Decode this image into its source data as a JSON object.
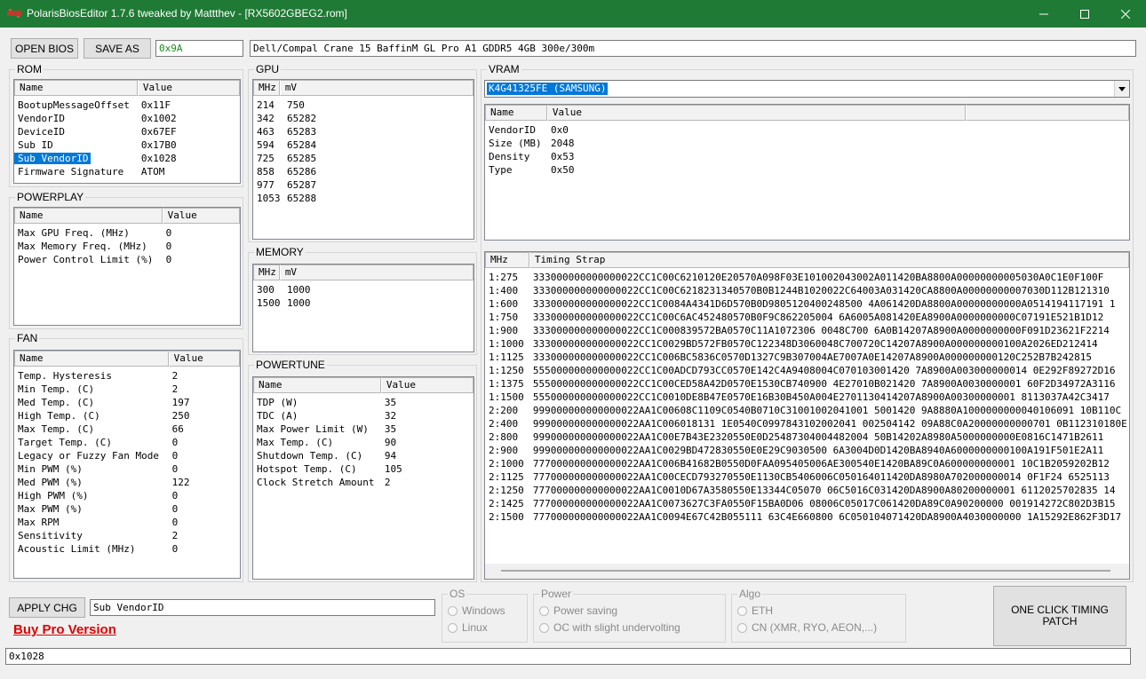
{
  "window": {
    "title": "PolarisBiosEditor 1.7.6 tweaked by Mattthev - [RX5602GBEG2.rom]"
  },
  "toolbar": {
    "open_label": "OPEN BIOS",
    "saveas_label": "SAVE AS",
    "checksum": "0x9A",
    "bios_desc": "Dell/Compal Crane 15 BaffinM GL Pro A1 GDDR5 4GB 300e/300m"
  },
  "rom": {
    "label": "ROM",
    "headers": [
      "Name",
      "Value"
    ],
    "rows": [
      [
        "BootupMessageOffset",
        "0x11F"
      ],
      [
        "VendorID",
        "0x1002"
      ],
      [
        "DeviceID",
        "0x67EF"
      ],
      [
        "Sub ID",
        "0x17B0"
      ],
      [
        "Sub VendorID",
        "0x1028"
      ],
      [
        "Firmware Signature",
        "ATOM"
      ]
    ]
  },
  "powerplay": {
    "label": "POWERPLAY",
    "headers": [
      "Name",
      "Value"
    ],
    "rows": [
      [
        "Max GPU Freq. (MHz)",
        "0"
      ],
      [
        "Max Memory Freq. (MHz)",
        "0"
      ],
      [
        "Power Control Limit (%)",
        "0"
      ]
    ]
  },
  "fan": {
    "label": "FAN",
    "headers": [
      "Name",
      "Value"
    ],
    "rows": [
      [
        "Temp. Hysteresis",
        "2"
      ],
      [
        "Min Temp. (C)",
        "2"
      ],
      [
        "Med Temp. (C)",
        "197"
      ],
      [
        "High Temp. (C)",
        "250"
      ],
      [
        "Max Temp. (C)",
        "66"
      ],
      [
        "Target Temp. (C)",
        "0"
      ],
      [
        "Legacy or Fuzzy Fan Mode",
        "0"
      ],
      [
        "Min PWM (%)",
        "0"
      ],
      [
        "Med PWM (%)",
        "122"
      ],
      [
        "High PWM (%)",
        "0"
      ],
      [
        "Max PWM (%)",
        "0"
      ],
      [
        "Max RPM",
        "0"
      ],
      [
        "Sensitivity",
        "2"
      ],
      [
        "Acoustic Limit (MHz)",
        "0"
      ]
    ]
  },
  "gpu": {
    "label": "GPU",
    "headers": [
      "MHz",
      "mV"
    ],
    "rows": [
      [
        "214",
        "750"
      ],
      [
        "342",
        "65282"
      ],
      [
        "463",
        "65283"
      ],
      [
        "594",
        "65284"
      ],
      [
        "725",
        "65285"
      ],
      [
        "858",
        "65286"
      ],
      [
        "977",
        "65287"
      ],
      [
        "1053",
        "65288"
      ]
    ]
  },
  "memory": {
    "label": "MEMORY",
    "headers": [
      "MHz",
      "mV"
    ],
    "rows": [
      [
        "300",
        "1000"
      ],
      [
        "1500",
        "1000"
      ]
    ]
  },
  "powertune": {
    "label": "POWERTUNE",
    "headers": [
      "Name",
      "Value"
    ],
    "rows": [
      [
        "TDP (W)",
        "35"
      ],
      [
        "TDC (A)",
        "32"
      ],
      [
        "Max Power Limit (W)",
        "35"
      ],
      [
        "Max Temp. (C)",
        "90"
      ],
      [
        "Shutdown Temp. (C)",
        "94"
      ],
      [
        "Hotspot Temp. (C)",
        "105"
      ],
      [
        "Clock Stretch Amount",
        "2"
      ]
    ]
  },
  "vram": {
    "label": "VRAM",
    "selected": "K4G41325FE (SAMSUNG)",
    "headers": [
      "Name",
      "Value"
    ],
    "rows": [
      [
        "VendorID",
        "0x0"
      ],
      [
        "Size (MB)",
        "2048"
      ],
      [
        "Density",
        "0x53"
      ],
      [
        "Type",
        "0x50"
      ]
    ],
    "timing_headers": [
      "MHz",
      "Timing Strap"
    ],
    "timings": [
      [
        "1:275",
        "333000000000000022CC1C00C6210120E20570A098F03E101002043002A011420BA8800A00000000005030A0C1E0F100F"
      ],
      [
        "1:400",
        "333000000000000022CC1C00C6218231340570B0B1244B1020022C64003A031420CA8800A00000000007030D112B121310"
      ],
      [
        "1:600",
        "333000000000000022CC1C0084A4341D6D570B0D9805120400248500 4A061420DA8800A00000000000A0514194117191 1"
      ],
      [
        "1:750",
        "333000000000000022CC1C00C6AC452480570B0F9C862205004 6A6005A081420EA8900A0000000000C07191E521B1D12"
      ],
      [
        "1:900",
        "333000000000000022CC1C000839572BA0570C11A1072306 0048C700 6A0B14207A8900A0000000000F091D23621F2214"
      ],
      [
        "1:1000",
        "333000000000000022CC1C0029BD572FB0570C122348D3060048C700720C14207A8900A000000000100A2026ED212414"
      ],
      [
        "1:1125",
        "333000000000000022CC1C006BC5836C0570D1327C9B307004AE7007A0E14207A8900A000000000120C252B7B242815"
      ],
      [
        "1:1250",
        "555000000000000022CC1C00ADCD793CC0570E142C4A9408004C070103001420 7A8900A003000000014 0E292F89272D16"
      ],
      [
        "1:1375",
        "555000000000000022CC1C00CED58A42D0570E1530CB740900 4E27010B021420 7A8900A0030000001 60F2D34972A3116"
      ],
      [
        "1:1500",
        "555000000000000022CC1C0010DE8B47E0570E16B30B450A004E2701130414207A8900A00300000001 8113037A42C3417"
      ],
      [
        "2:200",
        "999000000000000022AA1C00608C1109C0540B0710C31001002041001 5001420 9A8880A1000000000040106091 10B110C"
      ],
      [
        "2:400",
        "999000000000000022AA1C006018131 1E0540C0997843102002041 002504142 09A88C0A20000000000701 0B112310180E"
      ],
      [
        "2:800",
        "999000000000000022AA1C00E7B43E2320550E0D25487304004482004 50B14202A8980A5000000000E0816C1471B2611"
      ],
      [
        "2:900",
        "999000000000000022AA1C0029BD472830550E0E29C9030500 6A3004D0D1420BA8940A6000000000100A191F501E2A11"
      ],
      [
        "2:1000",
        "777000000000000022AA1C006B41682B0550D0FAA095405006AE300540E1420BA89C0A600000000001 10C1B2059202B12"
      ],
      [
        "2:1125",
        "777000000000000022AA1C00CECD793270550E1130CB5406006C050164011420DA8980A702000000014 0F1F24 6525113"
      ],
      [
        "2:1250",
        "777000000000000022AA1C0010D67A3580550E13344C05070 06C5016C031420DA8900A80200000001 6112025702835 14"
      ],
      [
        "2:1425",
        "777000000000000022AA1C0073627C3FA0550F15BA0D06 08006C05017C061420DA89C0A90200000 001914272C802D3B15"
      ],
      [
        "2:1500",
        "777000000000000022AA1C0094E67C42B055111 63C4E660800 6C050104071420DA8900A4030000000 1A15292E862F3D17"
      ]
    ]
  },
  "bottom": {
    "apply_label": "APPLY CHG",
    "edit_name": "Sub VendorID",
    "pro_link": "Buy Pro Version",
    "edit_value": "0x1028",
    "one_click_label": "ONE CLICK TIMING PATCH"
  },
  "os": {
    "label": "OS",
    "options": [
      "Windows",
      "Linux"
    ]
  },
  "power": {
    "label": "Power",
    "options": [
      "Power saving",
      "OC with slight undervolting"
    ]
  },
  "algo": {
    "label": "Algo",
    "options": [
      "ETH",
      "CN (XMR, RYO, AEON,...)"
    ]
  }
}
